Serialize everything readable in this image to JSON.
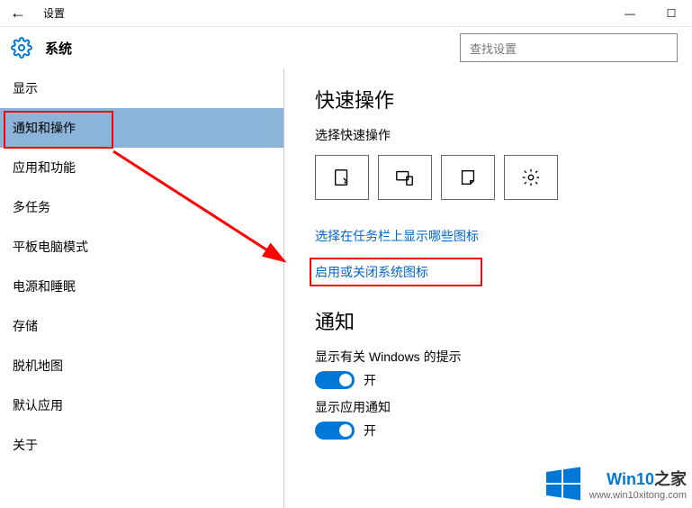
{
  "titlebar": {
    "title": "设置"
  },
  "header": {
    "page_title": "系统",
    "search_placeholder": "查找设置"
  },
  "sidebar": {
    "items": [
      {
        "label": "显示",
        "active": false
      },
      {
        "label": "通知和操作",
        "active": true
      },
      {
        "label": "应用和功能",
        "active": false
      },
      {
        "label": "多任务",
        "active": false
      },
      {
        "label": "平板电脑模式",
        "active": false
      },
      {
        "label": "电源和睡眠",
        "active": false
      },
      {
        "label": "存储",
        "active": false
      },
      {
        "label": "脱机地图",
        "active": false
      },
      {
        "label": "默认应用",
        "active": false
      },
      {
        "label": "关于",
        "active": false
      }
    ]
  },
  "content": {
    "quick_actions_title": "快速操作",
    "quick_actions_sub": "选择快速操作",
    "quick_tiles": [
      "tablet-mode",
      "connect",
      "note",
      "all-settings"
    ],
    "link1": "选择在任务栏上显示哪些图标",
    "link2": "启用或关闭系统图标",
    "notifications_title": "通知",
    "toggles": [
      {
        "label": "显示有关 Windows 的提示",
        "state": "开",
        "on": true
      },
      {
        "label": "显示应用通知",
        "state": "开",
        "on": true
      }
    ]
  },
  "watermark": {
    "brand_a": "Win10",
    "brand_b": "之家",
    "url": "www.win10xitong.com"
  }
}
